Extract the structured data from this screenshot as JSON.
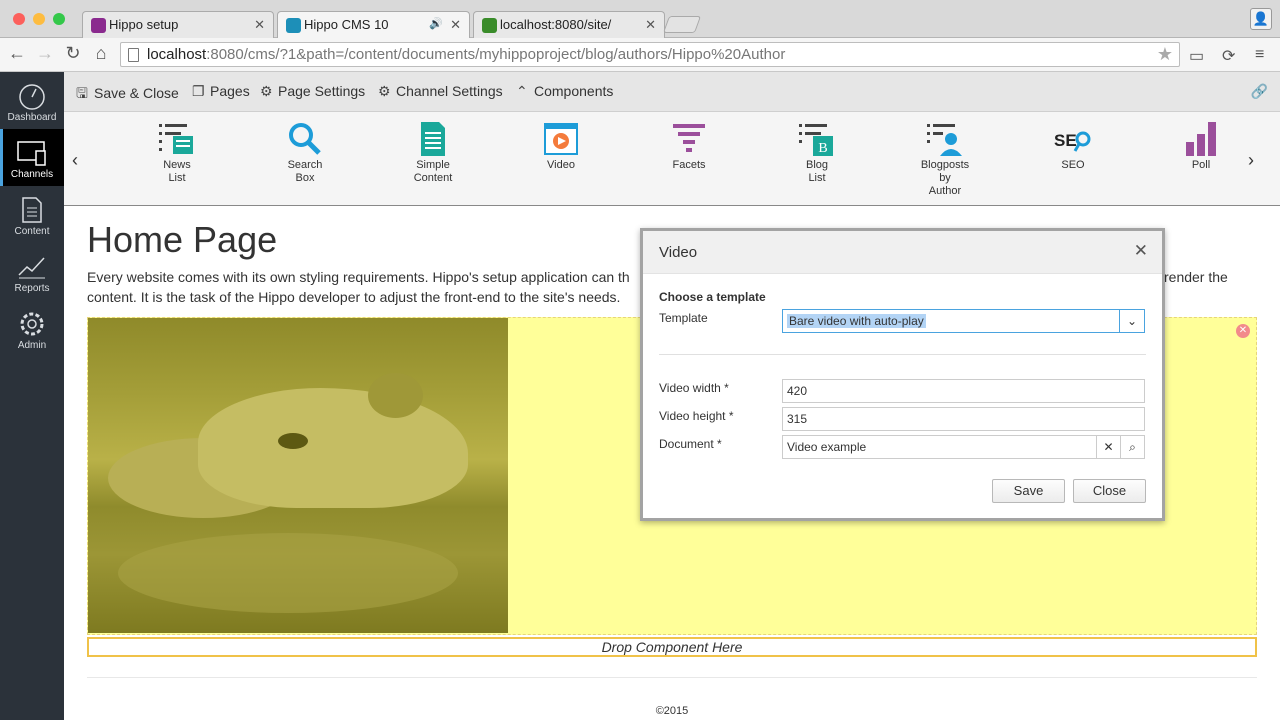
{
  "browser": {
    "tabs": [
      {
        "title": "Hippo setup",
        "favicon_color": "#8a2a8e"
      },
      {
        "title": "Hippo CMS 10",
        "favicon_color": "#1d8fb8"
      },
      {
        "title": "localhost:8080/site/",
        "favicon_color": "#3a8c2a"
      }
    ],
    "url_host": "localhost",
    "url_rest": ":8080/cms/?1&path=/content/documents/myhippoproject/blog/authors/Hippo%20Author"
  },
  "leftnav": [
    {
      "label": "Dashboard",
      "icon": "dashboard-icon"
    },
    {
      "label": "Channels",
      "icon": "channels-icon"
    },
    {
      "label": "Content",
      "icon": "content-icon"
    },
    {
      "label": "Reports",
      "icon": "reports-icon"
    },
    {
      "label": "Admin",
      "icon": "admin-icon"
    }
  ],
  "toolbar": {
    "save_close": "Save & Close",
    "pages": "Pages",
    "page_settings": "Page Settings",
    "channel_settings": "Channel Settings",
    "components": "Components"
  },
  "components": [
    {
      "l1": "News",
      "l2": "List",
      "l3": ""
    },
    {
      "l1": "Search",
      "l2": "Box",
      "l3": ""
    },
    {
      "l1": "Simple",
      "l2": "Content",
      "l3": ""
    },
    {
      "l1": "Video",
      "l2": "",
      "l3": ""
    },
    {
      "l1": "Facets",
      "l2": "",
      "l3": ""
    },
    {
      "l1": "Blog",
      "l2": "List",
      "l3": ""
    },
    {
      "l1": "Blogposts",
      "l2": "by",
      "l3": "Author"
    },
    {
      "l1": "SEO",
      "l2": "",
      "l3": ""
    },
    {
      "l1": "Poll",
      "l2": "",
      "l3": ""
    }
  ],
  "page": {
    "title": "Home Page",
    "intro_line1": "Every website comes with its own styling requirements. Hippo's setup application can th",
    "intro_line1_tail": "render the",
    "intro_line2": "content. It is the task of the Hippo developer to adjust the front-end to the site's needs.",
    "drop_zone": "Drop Component Here",
    "footer": "©2015"
  },
  "dialog": {
    "title": "Video",
    "section": "Choose a template",
    "template_label": "Template",
    "template_value": "Bare video with auto-play",
    "width_label": "Video width *",
    "width_value": "420",
    "height_label": "Video height *",
    "height_value": "315",
    "document_label": "Document *",
    "document_value": "Video example",
    "save": "Save",
    "close": "Close"
  },
  "colors": {
    "nav_bg": "#2b323a",
    "accent": "#4aa3df",
    "container_bg": "#ffff99",
    "dropzone_border": "#f0c248"
  }
}
